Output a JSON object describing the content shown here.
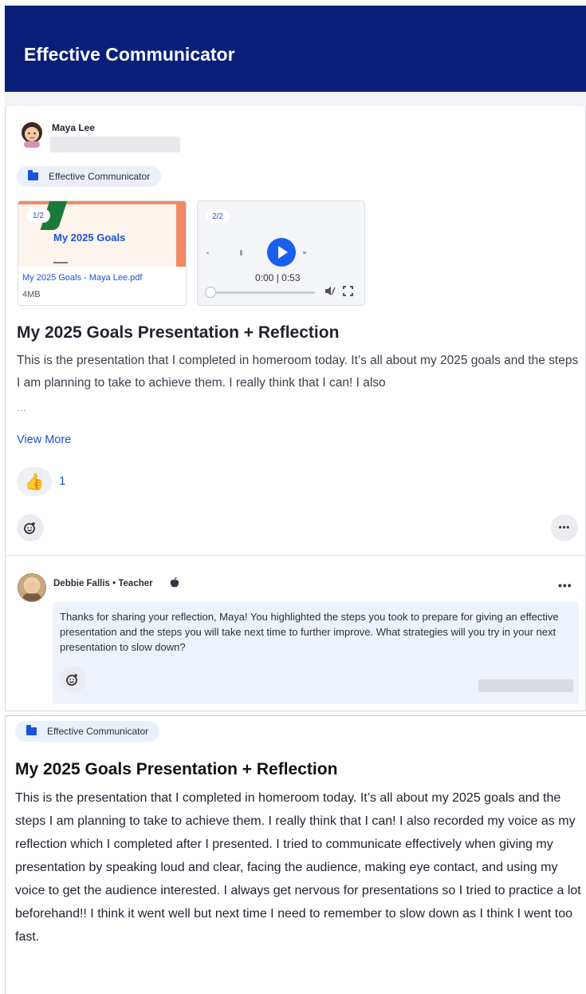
{
  "header": {
    "title": "Effective Communicator"
  },
  "post": {
    "author": {
      "name": "Maya Lee"
    },
    "tag": "Effective Communicator",
    "attachments": {
      "pdf": {
        "counter": "1/2",
        "slide_title": "My 2025 Goals",
        "file_name": "My 2025 Goals - Maya Lee.pdf",
        "file_size": "4MB"
      },
      "audio": {
        "counter": "2/2",
        "time": "0:00 | 0:53"
      }
    },
    "title": "My 2025 Goals Presentation + Reflection",
    "body_preview": "This is the presentation that I completed in homeroom today. It’s all about my 2025 goals and the steps I am planning to take to achieve them. I really think that I can! I also",
    "ellipsis": "...",
    "view_more": "View More",
    "reaction": {
      "emoji": "👍",
      "count": "1"
    },
    "more_icon": "•••"
  },
  "comment": {
    "author_line": "Debbie Fallis • Teacher",
    "text": "Thanks for sharing your reflection, Maya! You highlighted the steps you took to prepare for giving an effective presentation and the steps you will take next time to further improve. What strategies will you try in your next presentation to slow down?",
    "more_icon": "•••"
  },
  "expanded": {
    "tag": "Effective Communicator",
    "title": "My 2025 Goals Presentation + Reflection",
    "body": "This is the presentation that I completed in homeroom today. It’s all about my 2025 goals and the steps I am planning to take to achieve them. I really think that I can! I also recorded my voice as my reflection which I completed after I presented. I tried to communicate effectively when giving my presentation by speaking loud and clear, facing the audience, making eye contact, and using my voice to get the audience interested. I always get nervous for presentations so I tried to practice a lot beforehand!! I think it went well but next time I need to remember to slow down as I think I went too fast."
  },
  "icons": {
    "folder": "folder-icon",
    "play": "play-icon",
    "mute": "mute-icon",
    "fullscreen": "fullscreen-icon",
    "add_reaction": "add-reaction-icon",
    "thumbs_up": "thumbs-up-icon",
    "teacher": "apple-icon"
  },
  "colors": {
    "header_bg": "#0a1f7a",
    "accent": "#1a53d9",
    "play": "#1a5ff0"
  }
}
